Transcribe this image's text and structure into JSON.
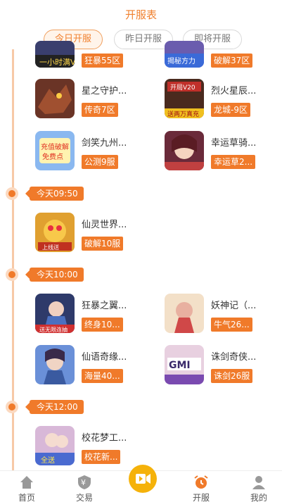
{
  "header": {
    "title": "开服表"
  },
  "tabs": [
    {
      "label": "今日开服",
      "active": true
    },
    {
      "label": "昨日开服",
      "active": false
    },
    {
      "label": "即将开服",
      "active": false
    }
  ],
  "colors": {
    "accent": "#f07a2a",
    "accent_light": "#fbd9c0",
    "center_button": "#f5b20a"
  },
  "games": [
    {
      "name": "",
      "badge": "狂暴55区",
      "thumb": "#3a3f6e"
    },
    {
      "name": "",
      "badge": "破解37区",
      "thumb": "#6a5cae"
    },
    {
      "name": "星之守护...",
      "badge": "传奇7区",
      "thumb": "#8a3c2a"
    },
    {
      "name": "烈火星辰...",
      "badge": "龙城-9区",
      "thumb": "#5a2e22"
    },
    {
      "name": "剑笑九州...",
      "badge": "公测9服",
      "thumb": "#5a8bd8"
    },
    {
      "name": "幸运草骑...",
      "badge": "幸运草2...",
      "thumb": "#7a3a4c"
    },
    {
      "name": "仙灵世界...",
      "badge": "破解10服",
      "thumb": "#d8a030"
    },
    {
      "name": "狂暴之翼...",
      "badge": "终身10...",
      "thumb": "#3a4c7e"
    },
    {
      "name": "妖神记（...",
      "badge": "牛气26...",
      "thumb": "#e8c0a8"
    },
    {
      "name": "仙语奇缘...",
      "badge": "海量40...",
      "thumb": "#4a6ab0"
    },
    {
      "name": "诛剑奇侠...",
      "badge": "诛剑26服",
      "thumb": "#e0c8d8"
    },
    {
      "name": "校花梦工...",
      "badge": "校花新...",
      "thumb": "#c8a8c8"
    }
  ],
  "times": [
    {
      "label": "今天09:50"
    },
    {
      "label": "今天10:00"
    },
    {
      "label": "今天12:00"
    }
  ],
  "tabbar": [
    {
      "label": "首页",
      "icon": "home-icon",
      "active": false
    },
    {
      "label": "交易",
      "icon": "yen-shield-icon",
      "active": false
    },
    {
      "label": "",
      "icon": "video-icon",
      "active": false
    },
    {
      "label": "开服",
      "icon": "alarm-clock-icon",
      "active": true
    },
    {
      "label": "我的",
      "icon": "user-icon",
      "active": false
    }
  ]
}
